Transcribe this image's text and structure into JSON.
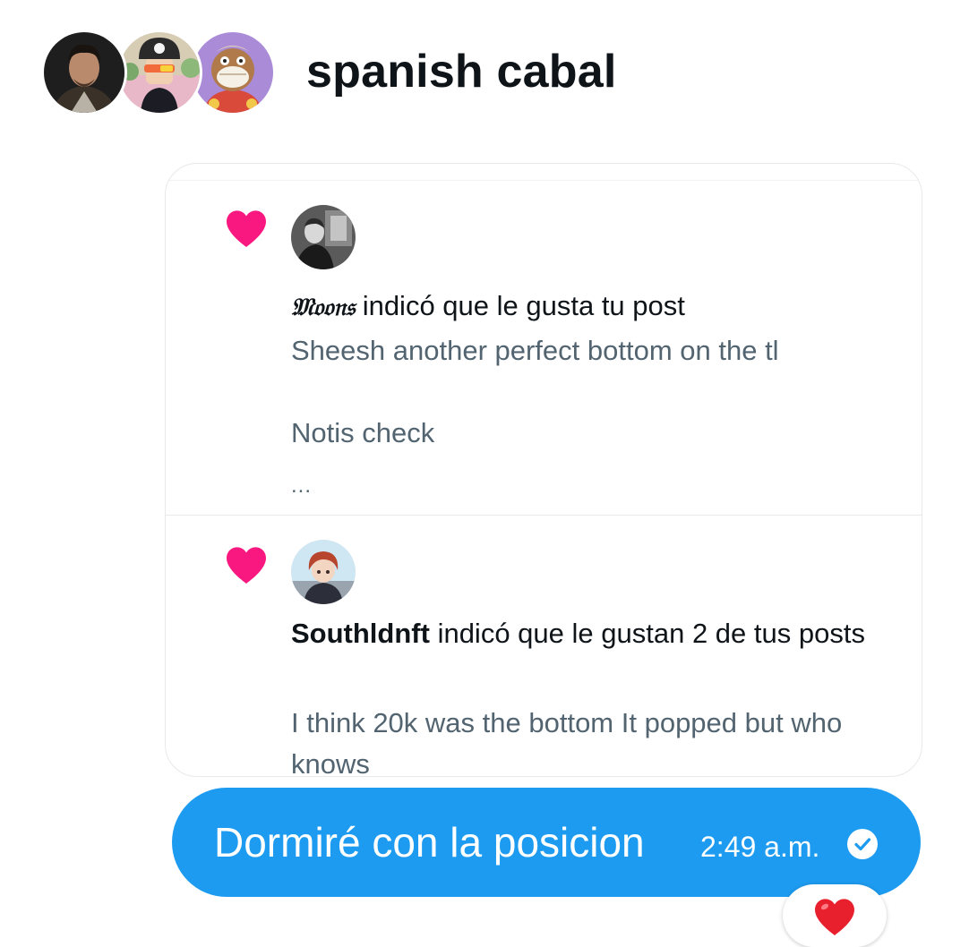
{
  "conversation": {
    "title": "spanish cabal",
    "participants": [
      {
        "avatar": "avatar-man-portrait"
      },
      {
        "avatar": "avatar-skull-cap-character"
      },
      {
        "avatar": "avatar-ape-character"
      }
    ]
  },
  "notifications": [
    {
      "icon": "heart-icon",
      "user": "𝔐𝔬𝔬𝔫𝔰",
      "action": " indicó que le gusta tu post",
      "preview_line1": "Sheesh another perfect bottom on the tl",
      "preview_line2": "Notis check",
      "preview_ellipsis": "..."
    },
    {
      "icon": "heart-icon",
      "user": "Southldnft",
      "action": " indicó que le gustan 2 de tus posts",
      "preview": "I think 20k was the bottom It popped but who knows"
    }
  ],
  "message": {
    "text": "Dormiré con la posicion",
    "time": "2:49 a.m.",
    "status_icon": "read-check-icon",
    "reaction": "❤️"
  },
  "colors": {
    "bubble": "#1d9bf0",
    "heart": "#f91880",
    "reaction_heart": "#e8202e",
    "secondary_text": "#536471"
  }
}
